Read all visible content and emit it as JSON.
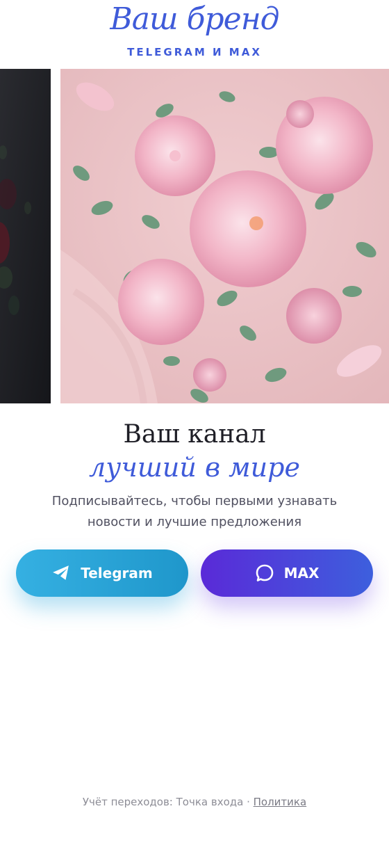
{
  "brand": {
    "logo_text": "Ваш бренд",
    "tagline": "TELEGRAM И MAX"
  },
  "hero": {
    "title": "Ваш канал",
    "subtitle": "лучший в мире",
    "description": "Подписывайтесь, чтобы первыми узнавать новости и лучшие предложения"
  },
  "buttons": {
    "telegram_label": "Telegram",
    "telegram_icon": "paper-plane-icon",
    "max_label": "MAX",
    "max_icon": "chat-bubble-icon"
  },
  "footer": {
    "tracking_text": "Учёт переходов: Точка входа",
    "separator": " · ",
    "policy_link": "Политика"
  },
  "colors": {
    "accent": "#3f5bd9",
    "telegram": "#2aa5dc",
    "max_start": "#5a2ad8",
    "max_end": "#3d5fdd"
  }
}
